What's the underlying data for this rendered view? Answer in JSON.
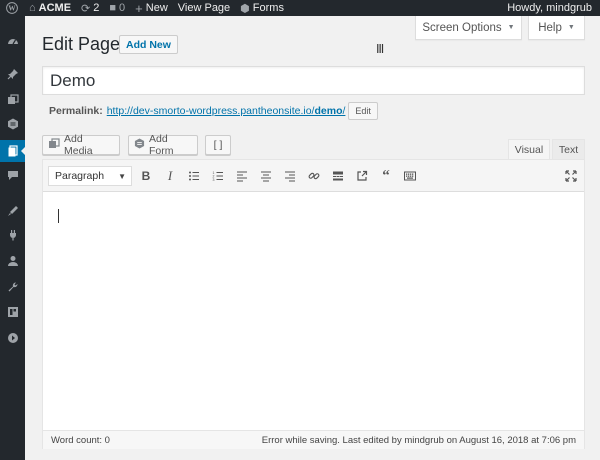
{
  "admin_bar": {
    "site_name": "ACME",
    "updates_count": "2",
    "comments_count": "0",
    "new_label": "New",
    "view_page_label": "View Page",
    "forms_label": "Forms",
    "greeting": "Howdy, mindgrub"
  },
  "side_menu": {
    "icons": [
      "dashboard-icon",
      "posts-icon",
      "media-icon",
      "forms-icon",
      "pages-icon",
      "comments-icon",
      "appearance-icon",
      "plugins-icon",
      "users-icon",
      "tools-icon",
      "settings-icon",
      "collapse-icon"
    ],
    "current": "pages-icon"
  },
  "screen_meta": {
    "screen_options_label": "Screen Options",
    "help_label": "Help"
  },
  "page": {
    "title": "Edit Page",
    "add_new_label": "Add New"
  },
  "post": {
    "title_value": "Demo",
    "permalink_label": "Permalink:",
    "permalink_base": "http://dev-smorto-wordpress.pantheonsite.io/",
    "permalink_slug": "demo",
    "permalink_trailing": "/",
    "edit_slug_label": "Edit"
  },
  "media_buttons": {
    "add_media_label": "Add Media",
    "add_form_label": "Add Form",
    "shortcode_label": "[ ]"
  },
  "editor": {
    "tabs": {
      "visual": "Visual",
      "text": "Text"
    },
    "active_tab": "visual",
    "format_value": "Paragraph",
    "toolbar_buttons": [
      "bold-icon",
      "italic-icon",
      "bulleted-list-icon",
      "numbered-list-icon",
      "align-left-icon",
      "align-center-icon",
      "align-right-icon",
      "insert-link-icon",
      "read-more-icon",
      "fullscreen-icon",
      "blockquote-icon",
      "toolbar-toggle-icon",
      "expand-icon"
    ],
    "content": ""
  },
  "status": {
    "word_count": "Word count: 0",
    "save_message": "Error while saving. Last edited by mindgrub on August 16, 2018 at 7:06 pm"
  },
  "colors": {
    "accent": "#0073aa",
    "admin_bar_bg": "#23282d",
    "page_bg": "#f1f1f1"
  }
}
